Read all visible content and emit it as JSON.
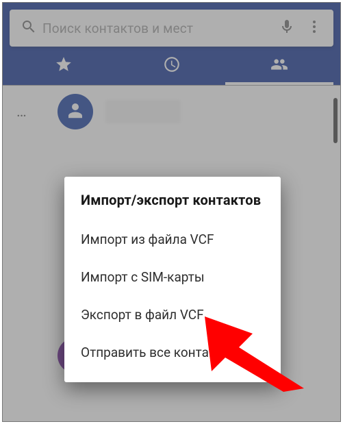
{
  "search": {
    "placeholder": "Поиск контактов и мест"
  },
  "tabs": {
    "favorites": "Избранное",
    "recents": "Недавние",
    "contacts": "Контакты",
    "active": "contacts"
  },
  "dialog": {
    "title": "Импорт/экспорт контактов",
    "items": [
      "Импорт из файла VCF",
      "Импорт с SIM-карты",
      "Экспорт в файл VCF",
      "Отправить все контакты"
    ]
  },
  "icons": {
    "search": "search-icon",
    "mic": "mic-icon",
    "overflow": "overflow-icon",
    "star": "star-icon",
    "clock": "clock-icon",
    "people": "people-icon",
    "person": "person-icon"
  },
  "colors": {
    "primary": "#0e2f93",
    "arrow": "#ff0000"
  }
}
